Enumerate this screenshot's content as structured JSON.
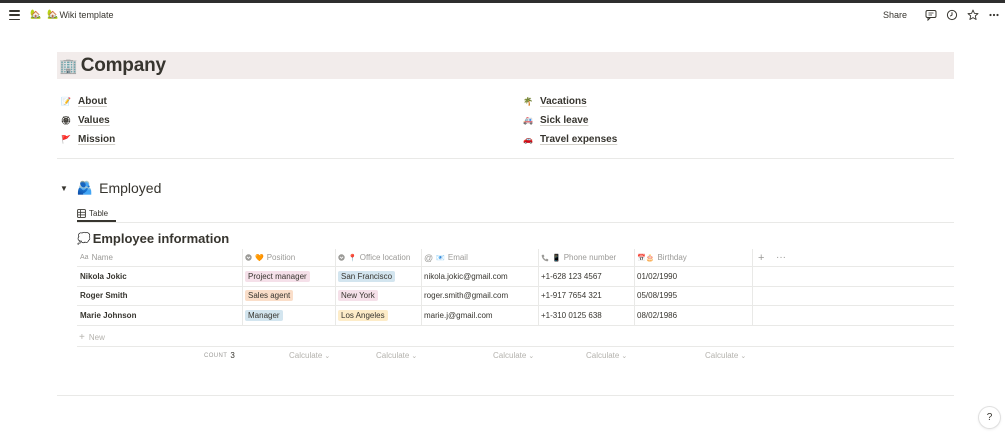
{
  "topbar": {
    "breadcrumb_icon": "🏡",
    "page_emoji": "🏡",
    "page_title": "Wiki template",
    "share_label": "Share"
  },
  "cover": {
    "emoji": "🏢",
    "title": "Company"
  },
  "left_links": [
    {
      "emoji": "📝",
      "label": "About"
    },
    {
      "emoji": "🏵",
      "label": "Values"
    },
    {
      "emoji": "🚩",
      "label": "Mission"
    }
  ],
  "right_links": [
    {
      "emoji": "🌴",
      "label": "Vacations"
    },
    {
      "emoji": "🚑",
      "label": "Sick leave"
    },
    {
      "emoji": "🚗",
      "label": "Travel expenses"
    }
  ],
  "section": {
    "emoji": "🫂",
    "title": "Employed",
    "tab_label": "Table"
  },
  "database": {
    "emoji": "💭",
    "title": "Employee information",
    "columns": {
      "name": "Name",
      "position": "Position",
      "office": "Office location",
      "email": "Email",
      "phone": "Phone number",
      "birthday": "Birthday"
    },
    "column_icons": {
      "name": "Aa",
      "position": "🧡",
      "office": "📍",
      "email": "📧",
      "phone": "📱",
      "birthday": "📅🎂"
    },
    "rows": [
      {
        "name": "Nikola Jokic",
        "position": "Project manager",
        "office": "San Francisco",
        "email": "nikola.jokic@gmail.com",
        "phone": "+1-628 123 4567",
        "birthday": "01/02/1990"
      },
      {
        "name": "Roger Smith",
        "position": "Sales agent",
        "office": "New York",
        "email": "roger.smith@gmail.com",
        "phone": "+1-917 7654 321",
        "birthday": "05/08/1995"
      },
      {
        "name": "Marie Johnson",
        "position": "Manager",
        "office": "Los Angeles",
        "email": "marie.j@gmail.com",
        "phone": "+1-310 0125 638",
        "birthday": "08/02/1986"
      }
    ],
    "new_label": "New",
    "count_label": "COUNT",
    "count_value": "3",
    "calculate_label": "Calculate"
  },
  "colors": {
    "cover_bg": "#f2eceb",
    "tag_pink": "#f5e0e9",
    "tag_orange": "#fadec9",
    "tag_blue": "#d3e5ef",
    "tag_yellow": "#fdecc8",
    "text": "#37352f",
    "muted": "#9b9a97"
  },
  "help_label": "?"
}
